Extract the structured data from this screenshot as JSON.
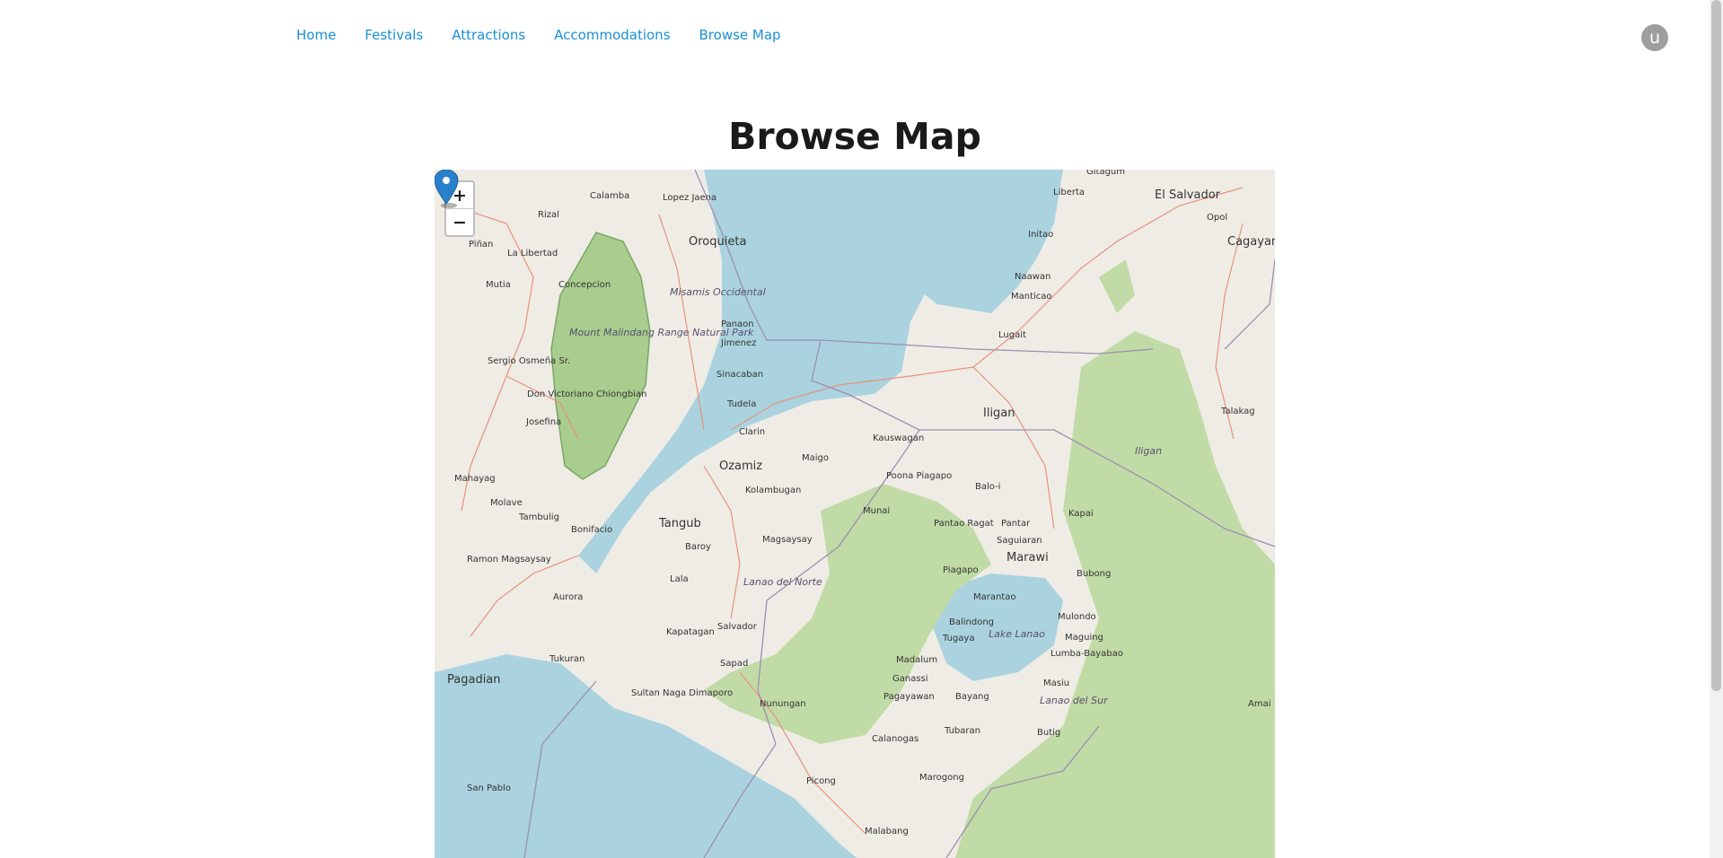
{
  "nav": {
    "items": [
      "Home",
      "Festivals",
      "Attractions",
      "Accommodations",
      "Browse Map"
    ]
  },
  "user": {
    "avatar_initial": "u"
  },
  "page": {
    "title": "Browse Map"
  },
  "map": {
    "zoom_in": "+",
    "zoom_out": "−",
    "marker_color": "#2a81cb",
    "place_labels": {
      "big": [
        "Oroquieta",
        "Ozamiz",
        "Tangub",
        "Iligan",
        "Marawi",
        "Pagadian",
        "El Salvador",
        "Cagayan de Oro"
      ],
      "small": [
        "Calamba",
        "Lopez Jaena",
        "Rizal",
        "Piñan",
        "La Libertad",
        "Mutia",
        "Concepcion",
        "Sergio Osmeña Sr.",
        "Don Victoriano Chiongbian",
        "Josefina",
        "Mahayag",
        "Molave",
        "Tambulig",
        "Bonifacio",
        "Ramon Magsaysay",
        "Aurora",
        "Tukuran",
        "Panaon",
        "Jimenez",
        "Sinacaban",
        "Tudela",
        "Clarin",
        "Kolambugan",
        "Maigo",
        "Kauswagan",
        "Poona Piagapo",
        "Balo-i",
        "Munai",
        "Pantao Ragat",
        "Pantar",
        "Saguiaran",
        "Kapai",
        "Bubong",
        "Magsaysay",
        "Baroy",
        "Lala",
        "Kapatagan",
        "Salvador",
        "Sapad",
        "Sultan Naga Dimaporo",
        "Nunungan",
        "Piagapo",
        "Marantao",
        "Balindong",
        "Tugaya",
        "Madalum",
        "Ganassi",
        "Pagayawan",
        "Bayang",
        "Tubaran",
        "Calanogas",
        "Marogong",
        "Butig",
        "Picong",
        "Malabang",
        "San Pablo",
        "Mulondo",
        "Maguing",
        "Lumba-Bayabao",
        "Masiu",
        "Amai",
        "Talakag",
        "Liberta",
        "Initao",
        "Naawan",
        "Manticao",
        "Lugait",
        "Opol",
        "Gitagum"
      ],
      "regions": [
        "Misamis Occidental",
        "Mount Malindang Range Natural Park",
        "Lanao del Norte",
        "Lake Lanao",
        "Lanao del Sur",
        "Iligan"
      ]
    }
  }
}
